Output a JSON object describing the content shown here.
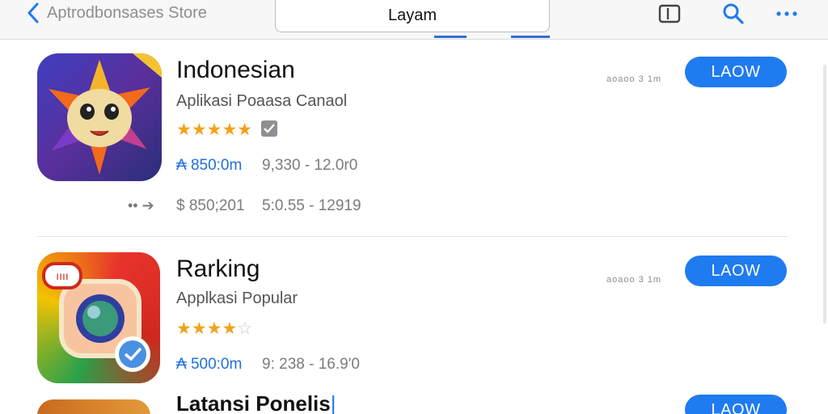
{
  "header": {
    "back_label": "Aptrodbonsases Store",
    "tab_label": "Layam"
  },
  "apps": [
    {
      "title": "Indonesian",
      "subtitle": "Aplikasi Poaasa Canaol",
      "rating": 4.5,
      "stars_text": "★★★★★",
      "meta1_blue": "₳ 850:0m",
      "meta1_gray": "9,330 - 12.0r0",
      "meta2_a": "$ 850;201",
      "meta2_b": "5:0.55 - 12919",
      "tiny": "aoaoo 3 1m",
      "button": "LAOW"
    },
    {
      "title": "Rarking",
      "subtitle": "Applkasi Popular",
      "rating": 4,
      "stars_text": "★★★★",
      "stars_empty": "☆",
      "meta1_blue": "₳ 500:0m",
      "meta1_gray": "9: 238 - 16.9'0",
      "tiny": "aoaoo 3 1m",
      "button": "LAOW"
    },
    {
      "title": "Latansi Ponelis",
      "button": "LAOW"
    }
  ],
  "colors": {
    "accent": "#1f7bf0",
    "star": "#f2a21b",
    "link_blue": "#1f6fe0"
  },
  "icons": [
    "chevron-left-icon",
    "tablet-icon",
    "search-icon",
    "more-dots-icon",
    "arrow-right-icon",
    "check-badge-icon"
  ]
}
